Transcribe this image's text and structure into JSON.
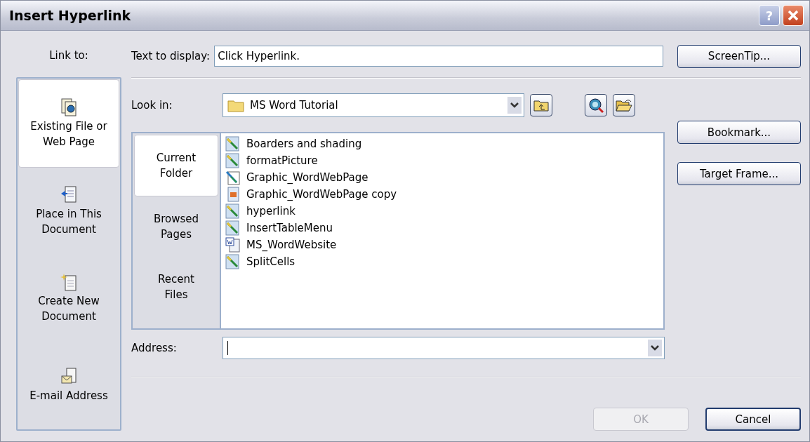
{
  "window": {
    "title": "Insert Hyperlink",
    "help": "?"
  },
  "link_to": {
    "label": "Link to:",
    "items": [
      {
        "label": "Existing File or Web Page",
        "kind": "existing",
        "selected": true
      },
      {
        "label": "Place in This Document",
        "kind": "place",
        "selected": false
      },
      {
        "label": "Create New Document",
        "kind": "new",
        "selected": false
      },
      {
        "label": "E-mail Address",
        "kind": "email",
        "selected": false
      }
    ]
  },
  "text_to_display": {
    "label": "Text to display:",
    "value": "Click Hyperlink."
  },
  "look_in": {
    "label": "Look in:",
    "value": "MS Word Tutorial"
  },
  "view_tabs": [
    {
      "label": "Current Folder",
      "selected": true
    },
    {
      "label": "Browsed Pages",
      "selected": false
    },
    {
      "label": "Recent Files",
      "selected": false
    }
  ],
  "files": [
    {
      "name": "Boarders and shading",
      "kind": "drawing"
    },
    {
      "name": "formatPicture",
      "kind": "drawing"
    },
    {
      "name": "Graphic_WordWebPage",
      "kind": "webpage"
    },
    {
      "name": "Graphic_WordWebPage copy",
      "kind": "image"
    },
    {
      "name": "hyperlink",
      "kind": "drawing"
    },
    {
      "name": "InsertTableMenu",
      "kind": "drawing"
    },
    {
      "name": "MS_WordWebsite",
      "kind": "word"
    },
    {
      "name": "SplitCells",
      "kind": "drawing"
    }
  ],
  "address": {
    "label": "Address:"
  },
  "side_buttons": [
    "ScreenTip...",
    "Bookmark...",
    "Target Frame..."
  ],
  "ok": {
    "label": "OK",
    "disabled": true
  },
  "cancel": {
    "label": "Cancel",
    "disabled": false
  }
}
